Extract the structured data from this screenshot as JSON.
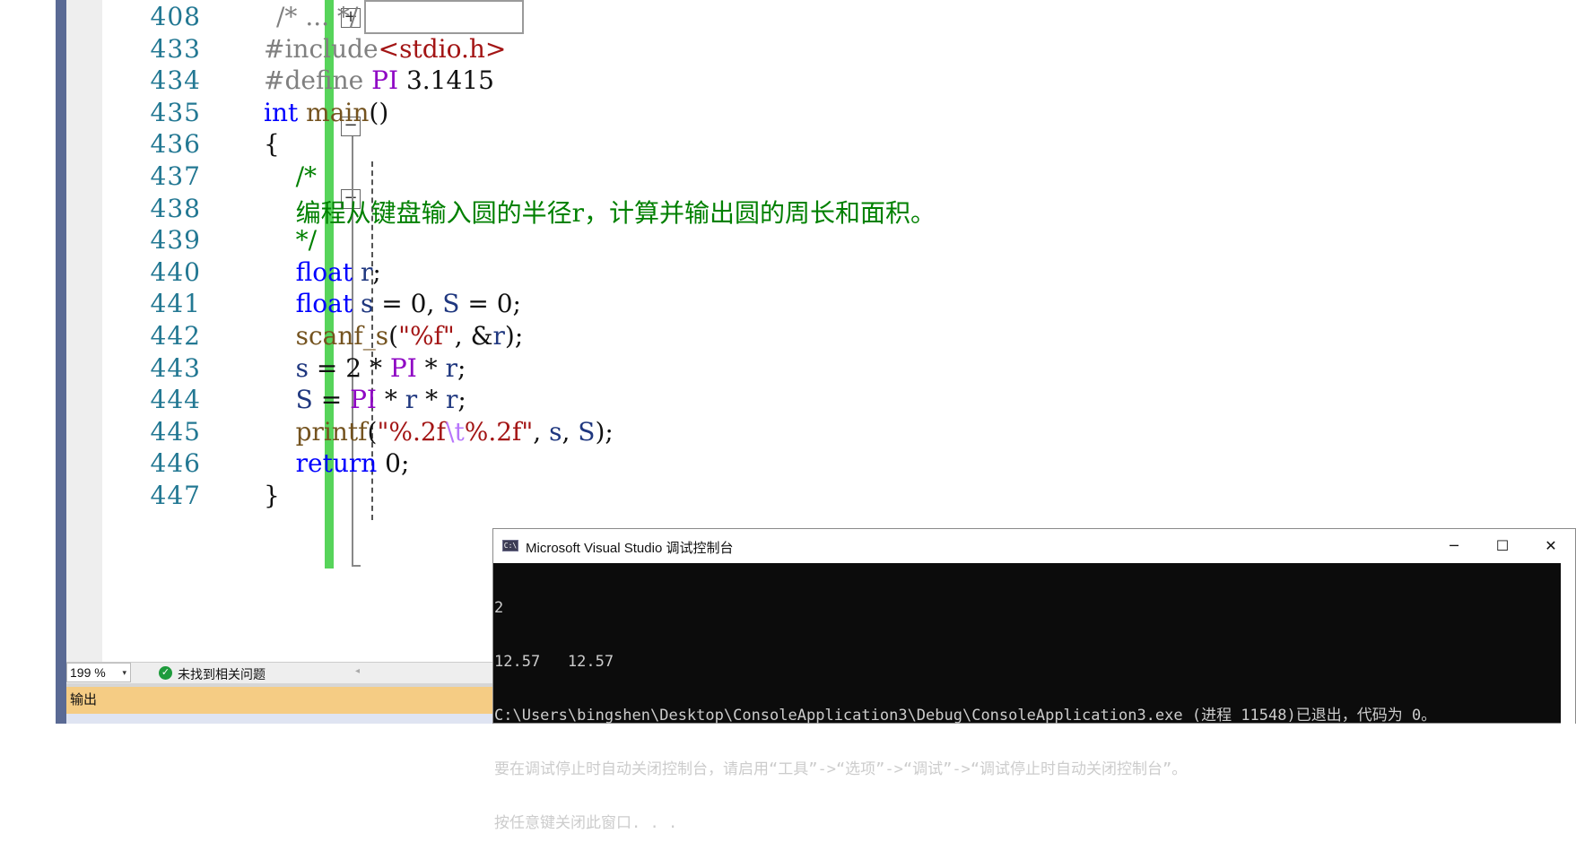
{
  "editor": {
    "lines": [
      {
        "number": "408",
        "segments": [
          {
            "text": "/* ... */",
            "cls": "pp"
          }
        ]
      },
      {
        "number": "433",
        "segments": [
          {
            "text": "#include",
            "cls": "pp"
          },
          {
            "text": "<stdio.h>",
            "cls": "str"
          }
        ]
      },
      {
        "number": "434",
        "segments": [
          {
            "text": "#define ",
            "cls": "pp"
          },
          {
            "text": "PI",
            "cls": "mac"
          },
          {
            "text": " 3.1415",
            "cls": ""
          }
        ]
      },
      {
        "number": "435",
        "segments": [
          {
            "text": "int",
            "cls": "kw"
          },
          {
            "text": " ",
            "cls": ""
          },
          {
            "text": "main",
            "cls": "fn"
          },
          {
            "text": "()",
            "cls": ""
          }
        ]
      },
      {
        "number": "436",
        "segments": [
          {
            "text": "{",
            "cls": ""
          }
        ]
      },
      {
        "number": "437",
        "segments": [
          {
            "text": "    /*",
            "cls": "cm"
          }
        ]
      },
      {
        "number": "438",
        "segments": [
          {
            "text": "    编程从键盘输入圆的半径r，计算并输出圆的周长和面积。",
            "cls": "cm"
          }
        ]
      },
      {
        "number": "439",
        "segments": [
          {
            "text": "    */",
            "cls": "cm"
          }
        ]
      },
      {
        "number": "440",
        "segments": [
          {
            "text": "    ",
            "cls": ""
          },
          {
            "text": "float",
            "cls": "kw"
          },
          {
            "text": " ",
            "cls": ""
          },
          {
            "text": "r",
            "cls": "var"
          },
          {
            "text": ";",
            "cls": ""
          }
        ]
      },
      {
        "number": "441",
        "segments": [
          {
            "text": "    ",
            "cls": ""
          },
          {
            "text": "float",
            "cls": "kw"
          },
          {
            "text": " ",
            "cls": ""
          },
          {
            "text": "s",
            "cls": "var"
          },
          {
            "text": " = 0, ",
            "cls": ""
          },
          {
            "text": "S",
            "cls": "var"
          },
          {
            "text": " = 0;",
            "cls": ""
          }
        ]
      },
      {
        "number": "442",
        "segments": [
          {
            "text": "    ",
            "cls": ""
          },
          {
            "text": "scanf_s",
            "cls": "fn"
          },
          {
            "text": "(",
            "cls": ""
          },
          {
            "text": "\"%f\"",
            "cls": "str"
          },
          {
            "text": ", &",
            "cls": ""
          },
          {
            "text": "r",
            "cls": "var"
          },
          {
            "text": ");",
            "cls": ""
          }
        ]
      },
      {
        "number": "443",
        "segments": [
          {
            "text": "    ",
            "cls": ""
          },
          {
            "text": "s",
            "cls": "var"
          },
          {
            "text": " = 2 * ",
            "cls": ""
          },
          {
            "text": "PI",
            "cls": "mac"
          },
          {
            "text": " * ",
            "cls": ""
          },
          {
            "text": "r",
            "cls": "var"
          },
          {
            "text": ";",
            "cls": ""
          }
        ]
      },
      {
        "number": "444",
        "segments": [
          {
            "text": "    ",
            "cls": ""
          },
          {
            "text": "S",
            "cls": "var"
          },
          {
            "text": " = ",
            "cls": ""
          },
          {
            "text": "PI",
            "cls": "mac"
          },
          {
            "text": " * ",
            "cls": ""
          },
          {
            "text": "r",
            "cls": "var"
          },
          {
            "text": " * ",
            "cls": ""
          },
          {
            "text": "r",
            "cls": "var"
          },
          {
            "text": ";",
            "cls": ""
          }
        ]
      },
      {
        "number": "445",
        "segments": [
          {
            "text": "    ",
            "cls": ""
          },
          {
            "text": "printf",
            "cls": "fn"
          },
          {
            "text": "(",
            "cls": ""
          },
          {
            "text": "\"%.2f",
            "cls": "str"
          },
          {
            "text": "\\t",
            "cls": "esc"
          },
          {
            "text": "%.2f\"",
            "cls": "str"
          },
          {
            "text": ", ",
            "cls": ""
          },
          {
            "text": "s",
            "cls": "var"
          },
          {
            "text": ", ",
            "cls": ""
          },
          {
            "text": "S",
            "cls": "var"
          },
          {
            "text": ");",
            "cls": ""
          }
        ]
      },
      {
        "number": "446",
        "segments": [
          {
            "text": "    ",
            "cls": ""
          },
          {
            "text": "return",
            "cls": "kw"
          },
          {
            "text": " 0;",
            "cls": ""
          }
        ]
      },
      {
        "number": "447",
        "segments": [
          {
            "text": "}",
            "cls": ""
          }
        ]
      }
    ]
  },
  "statusbar": {
    "zoom": "199 %",
    "issues": "未找到相关问题"
  },
  "output_panel": {
    "label": "输出"
  },
  "console": {
    "title": "Microsoft Visual Studio 调试控制台",
    "icon_text": "C:\\",
    "lines": [
      "2",
      "12.57   12.57",
      "C:\\Users\\bingshen\\Desktop\\ConsoleApplication3\\Debug\\ConsoleApplication3.exe (进程 11548)已退出，代码为 0。",
      "要在调试停止时自动关闭控制台，请启用“工具”->“选项”->“调试”->“调试停止时自动关闭控制台”。",
      "按任意键关闭此窗口. . ."
    ]
  },
  "icons": {
    "fold_expand": "+",
    "fold_collapse": "−",
    "minimize": "─",
    "maximize": "☐",
    "close": "✕",
    "check": "✓",
    "dropdown": "▾",
    "scroll_left": "◂"
  }
}
